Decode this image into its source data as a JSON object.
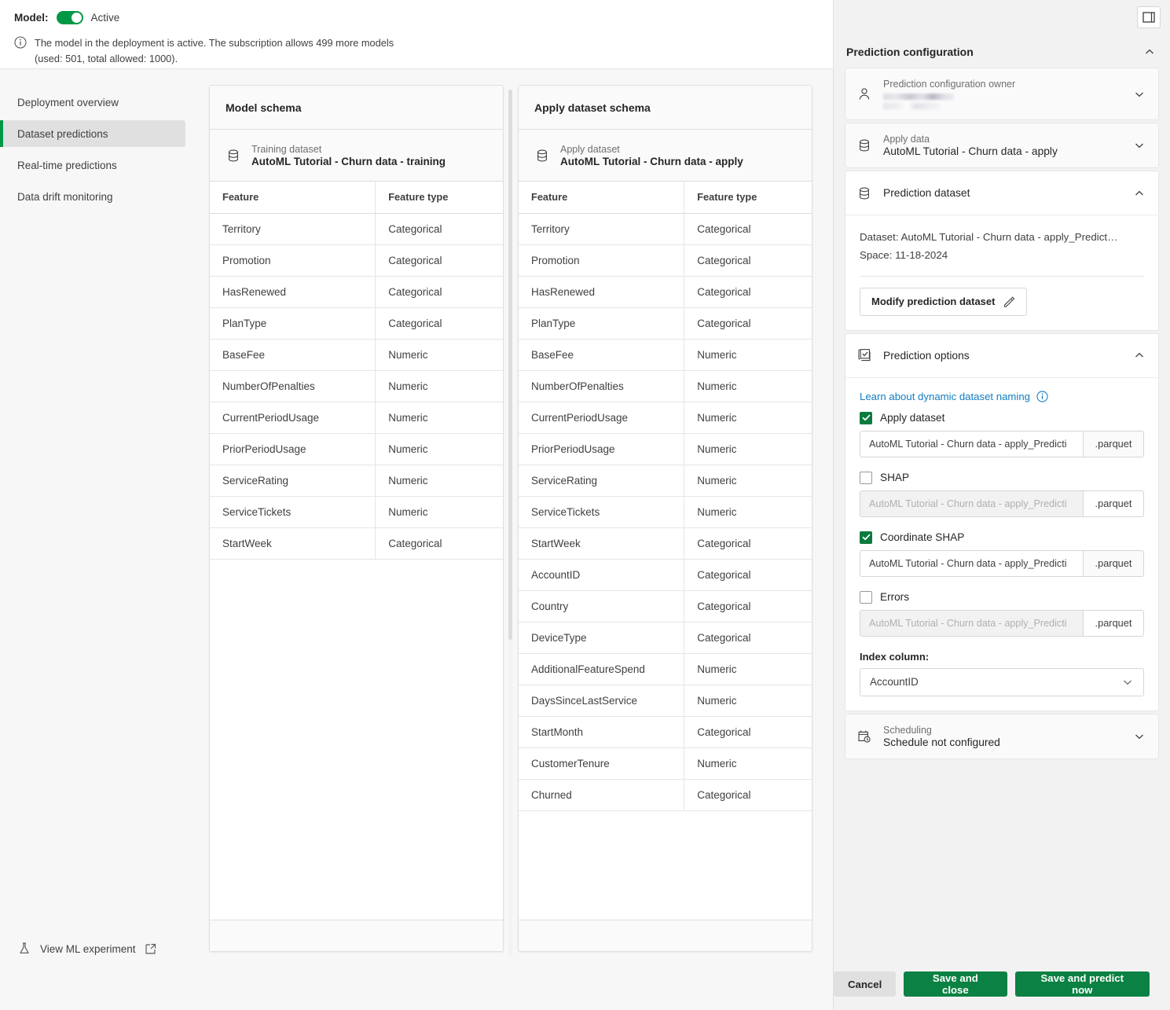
{
  "model_bar": {
    "label": "Model:",
    "toggle_state": "on",
    "state_text": "Active",
    "info_icon": "info-circle-icon",
    "notice_line1": "The model in the deployment is active. The subscription allows 499 more models",
    "notice_line2": "(used: 501, total allowed: 1000)."
  },
  "sidebar": {
    "items": [
      {
        "label": "Deployment overview",
        "active": false
      },
      {
        "label": "Dataset predictions",
        "active": true
      },
      {
        "label": "Real-time predictions",
        "active": false
      },
      {
        "label": "Data drift monitoring",
        "active": false
      }
    ],
    "ml_experiment_link": "View ML experiment",
    "ml_experiment_icon": "flask-icon",
    "external_link_icon": "external-link-icon"
  },
  "model_schema_card": {
    "title": "Model schema",
    "dataset_icon": "database-icon",
    "dataset_label": "Training dataset",
    "dataset_name": "AutoML Tutorial - Churn data - training",
    "columns": [
      "Feature",
      "Feature type"
    ],
    "rows": [
      [
        "Territory",
        "Categorical"
      ],
      [
        "Promotion",
        "Categorical"
      ],
      [
        "HasRenewed",
        "Categorical"
      ],
      [
        "PlanType",
        "Categorical"
      ],
      [
        "BaseFee",
        "Numeric"
      ],
      [
        "NumberOfPenalties",
        "Numeric"
      ],
      [
        "CurrentPeriodUsage",
        "Numeric"
      ],
      [
        "PriorPeriodUsage",
        "Numeric"
      ],
      [
        "ServiceRating",
        "Numeric"
      ],
      [
        "ServiceTickets",
        "Numeric"
      ],
      [
        "StartWeek",
        "Categorical"
      ]
    ]
  },
  "apply_schema_card": {
    "title": "Apply dataset schema",
    "dataset_icon": "database-icon",
    "dataset_label": "Apply dataset",
    "dataset_name": "AutoML Tutorial - Churn data - apply",
    "columns": [
      "Feature",
      "Feature type"
    ],
    "rows": [
      [
        "Territory",
        "Categorical"
      ],
      [
        "Promotion",
        "Categorical"
      ],
      [
        "HasRenewed",
        "Categorical"
      ],
      [
        "PlanType",
        "Categorical"
      ],
      [
        "BaseFee",
        "Numeric"
      ],
      [
        "NumberOfPenalties",
        "Numeric"
      ],
      [
        "CurrentPeriodUsage",
        "Numeric"
      ],
      [
        "PriorPeriodUsage",
        "Numeric"
      ],
      [
        "ServiceRating",
        "Numeric"
      ],
      [
        "ServiceTickets",
        "Numeric"
      ],
      [
        "StartWeek",
        "Categorical"
      ],
      [
        "AccountID",
        "Categorical"
      ],
      [
        "Country",
        "Categorical"
      ],
      [
        "DeviceType",
        "Categorical"
      ],
      [
        "AdditionalFeatureSpend",
        "Numeric"
      ],
      [
        "DaysSinceLastService",
        "Numeric"
      ],
      [
        "StartMonth",
        "Categorical"
      ],
      [
        "CustomerTenure",
        "Numeric"
      ],
      [
        "Churned",
        "Categorical"
      ]
    ]
  },
  "right_panel": {
    "panel_toggle_icon": "panel-layout-icon",
    "title": "Prediction configuration",
    "collapse_icon": "chevron-up-icon",
    "owner": {
      "icon": "person-icon",
      "label": "Prediction configuration owner",
      "value": "",
      "chevron": "chevron-down-icon"
    },
    "apply_data": {
      "icon": "database-icon",
      "label": "Apply data",
      "value": "AutoML Tutorial - Churn data - apply",
      "chevron": "chevron-down-icon"
    },
    "prediction_dataset": {
      "icon": "database-icon",
      "title": "Prediction dataset",
      "chevron": "chevron-up-icon",
      "dataset_line": "Dataset: AutoML Tutorial - Churn data - apply_Predict…",
      "space_line": "Space: 11-18-2024",
      "modify_button": "Modify prediction dataset",
      "modify_button_icon": "pencil-icon"
    },
    "prediction_options": {
      "icon": "checkbox-list-icon",
      "title": "Prediction options",
      "chevron": "chevron-up-icon",
      "learn_link": "Learn about dynamic dataset naming",
      "learn_info_icon": "info-circle-icon",
      "options": [
        {
          "label": "Apply dataset",
          "checked": true,
          "filename": "AutoML Tutorial - Churn data - apply_Predicti",
          "extension": ".parquet"
        },
        {
          "label": "SHAP",
          "checked": false,
          "filename": "AutoML Tutorial - Churn data - apply_Predicti",
          "extension": ".parquet"
        },
        {
          "label": "Coordinate SHAP",
          "checked": true,
          "filename": "AutoML Tutorial - Churn data - apply_Predicti",
          "extension": ".parquet"
        },
        {
          "label": "Errors",
          "checked": false,
          "filename": "AutoML Tutorial - Churn data - apply_Predicti",
          "extension": ".parquet"
        }
      ],
      "index_column_label": "Index column:",
      "index_column_value": "AccountID",
      "index_column_chevron": "chevron-down-icon"
    },
    "scheduling": {
      "icon": "calendar-clock-icon",
      "label": "Scheduling",
      "value": "Schedule not configured",
      "chevron": "chevron-down-icon"
    },
    "footer": {
      "cancel": "Cancel",
      "save_close": "Save and close",
      "save_predict": "Save and predict now"
    }
  },
  "colors": {
    "accent_green": "#009845",
    "button_green": "#0b8143",
    "checkbox_green": "#0b7a3d",
    "link_blue": "#117dc1",
    "panel_bg": "#f2f2f2",
    "nav_bg": "#f7f7f7",
    "active_nav_bg": "#e0e0e0"
  }
}
